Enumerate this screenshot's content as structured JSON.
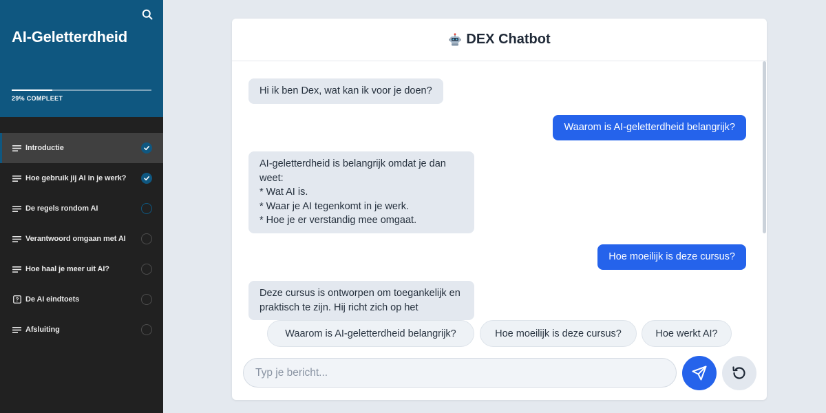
{
  "sidebar": {
    "course_title": "AI-Geletterdheid",
    "progress_percent": 29,
    "progress_label": "29% COMPLEET",
    "search_icon": "search-icon",
    "lessons": [
      {
        "label": "Introductie",
        "icon": "lines-icon",
        "status": "done",
        "active": true
      },
      {
        "label": "Hoe gebruik jij AI in je werk?",
        "icon": "lines-icon",
        "status": "done",
        "active": false
      },
      {
        "label": "De regels rondom AI",
        "icon": "lines-icon",
        "status": "todo",
        "active": false
      },
      {
        "label": "Verantwoord omgaan met AI",
        "icon": "lines-icon",
        "status": "todo",
        "active": false
      },
      {
        "label": "Hoe haal je meer uit AI?",
        "icon": "lines-icon",
        "status": "todo",
        "active": false
      },
      {
        "label": "De AI eindtoets",
        "icon": "quiz-icon",
        "status": "todo",
        "active": false
      },
      {
        "label": "Afsluiting",
        "icon": "lines-icon",
        "status": "todo",
        "active": false
      }
    ]
  },
  "chat": {
    "title": "DEX Chatbot",
    "title_icon": "robot-icon",
    "messages": [
      {
        "role": "bot",
        "text": "Hi ik ben Dex, wat kan ik voor je doen?"
      },
      {
        "role": "user",
        "text": "Waarom is AI-geletterdheid belangrijk?"
      },
      {
        "role": "bot",
        "text": "AI-geletterdheid is belangrijk omdat je dan weet:\n* Wat AI is.\n* Waar je AI tegenkomt in je werk.\n* Hoe je er verstandig mee omgaat."
      },
      {
        "role": "user",
        "text": "Hoe moeilijk is deze cursus?"
      },
      {
        "role": "bot",
        "text": "Deze cursus is ontworpen om toegankelijk en praktisch te zijn. Hij richt zich op het"
      }
    ],
    "suggestions": [
      "Waarom is AI-geletterdheid belangrijk?",
      "Hoe moeilijk is deze cursus?",
      "Hoe werkt AI?"
    ],
    "input": {
      "placeholder": "Typ je bericht...",
      "value": ""
    },
    "send_icon": "send-icon",
    "reset_icon": "reset-icon"
  },
  "colors": {
    "sidebar_header": "#0f5780",
    "sidebar_bg": "#212121",
    "accent_blue": "#2563eb",
    "bot_bubble": "#e3e8ef",
    "page_bg": "#e4e9ef"
  }
}
